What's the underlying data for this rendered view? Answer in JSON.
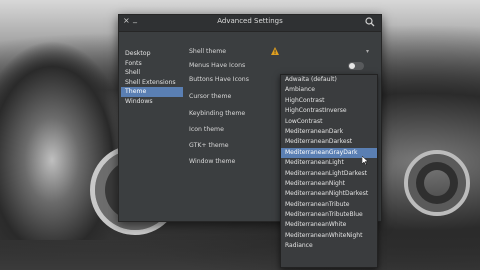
{
  "window": {
    "title": "Advanced Settings"
  },
  "sidebar": {
    "items": [
      {
        "label": "Desktop"
      },
      {
        "label": "Fonts"
      },
      {
        "label": "Shell"
      },
      {
        "label": "Shell Extensions"
      },
      {
        "label": "Theme",
        "active": true
      },
      {
        "label": "Windows"
      }
    ]
  },
  "settings": {
    "shell_theme": "Shell theme",
    "menus_have_icons": "Menus Have Icons",
    "buttons_have_icons": "Buttons Have Icons",
    "cursor_theme": "Cursor theme",
    "keybinding_theme": "Keybinding theme",
    "icon_theme": "Icon theme",
    "gtk_theme": "GTK+ theme",
    "window_theme": "Window theme"
  },
  "dropdown": {
    "options": [
      "Adwaita (default)",
      "Ambiance",
      "HighContrast",
      "HighContrastInverse",
      "LowContrast",
      "MediterraneanDark",
      "MediterraneanDarkest",
      "MediterraneanGrayDark",
      "MediterraneanLight",
      "MediterraneanLightDarkest",
      "MediterraneanNight",
      "MediterraneanNightDarkest",
      "MediterraneanTribute",
      "MediterraneanTributeBlue",
      "MediterraneanWhite",
      "MediterraneanWhiteNight",
      "Radiance"
    ],
    "selected": "MediterraneanGrayDark"
  },
  "colors": {
    "accent": "#5a7fb3",
    "window_bg": "#3b3e40",
    "warning": "#e0a020"
  }
}
